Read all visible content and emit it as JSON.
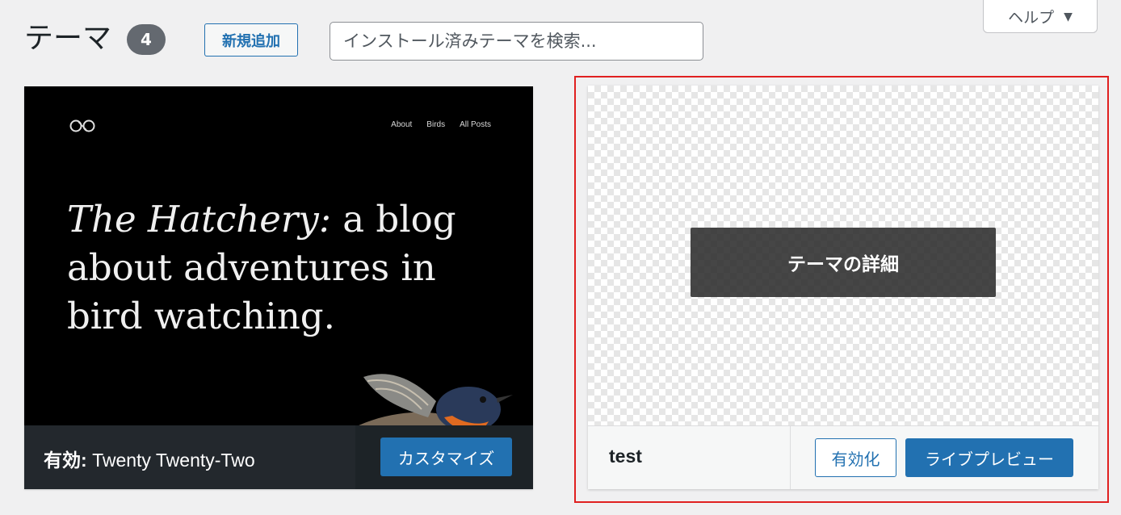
{
  "header": {
    "title": "テーマ",
    "count": "4",
    "add_new_label": "新規追加",
    "search_placeholder": "インストール済みテーマを検索...",
    "help_label": "ヘルプ"
  },
  "active_theme": {
    "preview": {
      "nav": [
        "About",
        "Birds",
        "All Posts"
      ],
      "headline_italic": "The Hatchery:",
      "headline_rest": " a blog about adventures in bird watching."
    },
    "active_prefix": "有効:",
    "name": "Twenty Twenty-Two",
    "customize_label": "カスタマイズ"
  },
  "test_theme": {
    "details_label": "テーマの詳細",
    "name": "test",
    "activate_label": "有効化",
    "live_preview_label": "ライブプレビュー"
  },
  "colors": {
    "accent": "#2271b1",
    "highlight_border": "#e02020",
    "badge": "#646970"
  }
}
